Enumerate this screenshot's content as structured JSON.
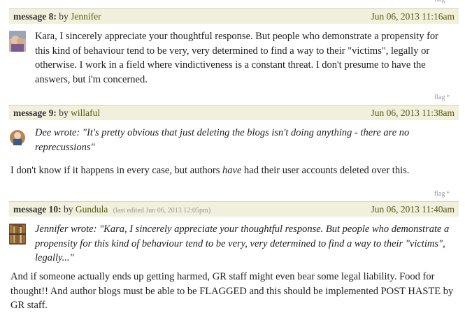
{
  "flag_label": "flag",
  "flag_star": "*",
  "messages": [
    {
      "label": "message 8:",
      "by": "by",
      "user": "Jennifer",
      "date": "Jun 06, 2013 11:16am",
      "body": "Kara, I sincerely appreciate your thoughtful response. But people who demonstrate a propensity for this kind of behaviour tend to be very, very determined to find a way to their \"victims\", legally or otherwise. I work in a field where vindictiveness is a constant threat. I don't presume to have the answers, but i'm concerned."
    },
    {
      "label": "message 9:",
      "by": "by",
      "user": "willaful",
      "date": "Jun 06, 2013 11:38am",
      "quote": "Dee wrote: \"It's pretty obvious that just deleting the blogs isn't doing anything - there are no reprecussions\"",
      "body_pre": "I don't know if it happens in every case, but authors ",
      "body_em": "have",
      "body_post": " had their user accounts deleted over this."
    },
    {
      "label": "message 10:",
      "by": "by",
      "user": "Gundula",
      "edited": "(last edited Jun 06, 2013 12:05pm)",
      "date": "Jun 06, 2013 11:40am",
      "quote": "Jennifer wrote: \"Kara, I sincerely appreciate your thoughtful response. But people who demonstrate a propensity for this kind of behaviour tend to be very, very determined to find a way to their \"victims\", legally...\"",
      "body": "And if someone actually ends up getting harmed, GR staff might even bear some legal liability. Food for thought!! And author blogs must be able to be FLAGGED and this should be implemented POST HASTE by GR staff."
    }
  ]
}
